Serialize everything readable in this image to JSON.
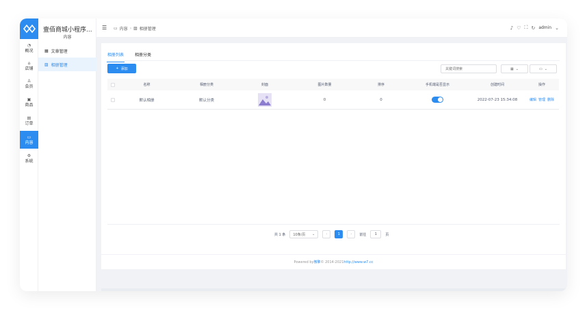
{
  "sidebar": {
    "items": [
      {
        "label": "概况",
        "icon": "dashboard-icon"
      },
      {
        "label": "店铺",
        "icon": "shop-icon"
      },
      {
        "label": "会员",
        "icon": "user-icon"
      },
      {
        "label": "商品",
        "icon": "goods-icon"
      },
      {
        "label": "订单",
        "icon": "order-icon"
      },
      {
        "label": "内容",
        "icon": "folder-icon",
        "active": true
      },
      {
        "label": "系统",
        "icon": "gear-icon"
      }
    ]
  },
  "subsidebar": {
    "store_name": "壹佰商城小程序...",
    "section": "内容",
    "items": [
      {
        "label": "文章管理",
        "icon": "article-icon"
      },
      {
        "label": "相册管理",
        "icon": "image-icon",
        "active": true
      }
    ]
  },
  "header": {
    "breadcrumbs": [
      "内容",
      "相册管理"
    ],
    "user": "admin"
  },
  "tabs": [
    "相册列表",
    "相册分类"
  ],
  "toolbar": {
    "add_label": "添加",
    "search_placeholder": "关键词搜索"
  },
  "table": {
    "columns": [
      "名称",
      "相册分类",
      "封面",
      "图片数量",
      "排序",
      "手机端是否显示",
      "创建时间",
      "操作"
    ],
    "rows": [
      {
        "name": "默认相册",
        "category": "默认分类",
        "image_count": "0",
        "sort": "0",
        "show_mobile": true,
        "created": "2022-07-23 15:34:08",
        "ops": [
          "编辑",
          "管理",
          "删除"
        ]
      }
    ]
  },
  "pagination": {
    "total": "共 1 条",
    "page_size": "10条/页",
    "current": "1",
    "goto_label": "前往",
    "goto_value": "1",
    "page_suffix": "页"
  },
  "footer": {
    "prefix": "Powered by",
    "brand": "微擎",
    "copyright": "© 2014-2021",
    "link": "http://www.w7.cc"
  },
  "colors": {
    "accent": "#2d8cf0",
    "background": "#f0f2f5"
  }
}
